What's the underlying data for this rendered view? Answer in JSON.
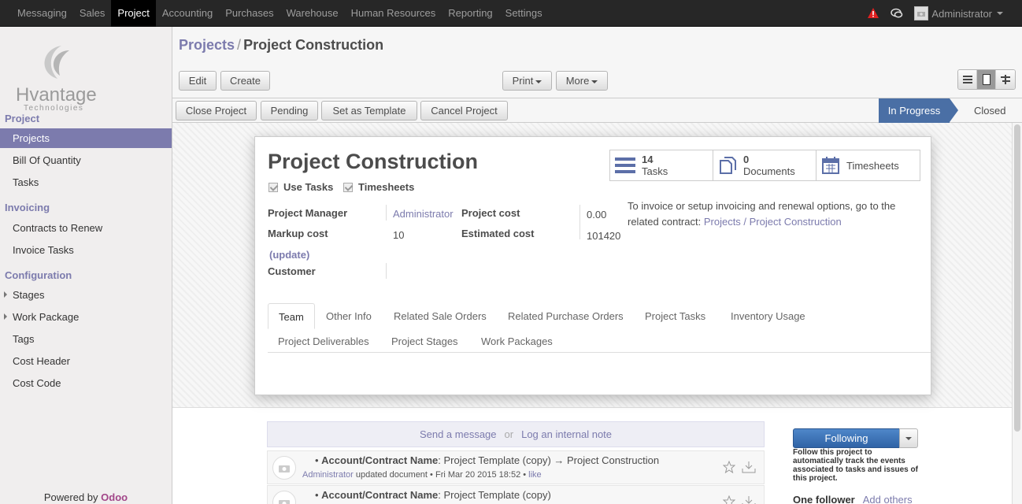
{
  "topnav": {
    "items": [
      "Messaging",
      "Sales",
      "Project",
      "Accounting",
      "Purchases",
      "Warehouse",
      "Human Resources",
      "Reporting",
      "Settings"
    ],
    "active_index": 2,
    "user": "Administrator"
  },
  "sidebar": {
    "logo_text": "Hvantage",
    "logo_sub": "Technologies",
    "sections": {
      "project": "Project",
      "invoicing": "Invoicing",
      "configuration": "Configuration"
    },
    "project_items": [
      "Projects",
      "Bill Of Quantity",
      "Tasks"
    ],
    "invoicing_items": [
      "Contracts to Renew",
      "Invoice Tasks"
    ],
    "configuration_items": [
      "Stages",
      "Work Package",
      "Tags",
      "Cost Header",
      "Cost Code"
    ],
    "powered_by": "Powered by",
    "powered_brand": "Odoo"
  },
  "breadcrumb": {
    "parent": "Projects",
    "separator": "/",
    "current": "Project Construction"
  },
  "toolbar": {
    "edit": "Edit",
    "create": "Create",
    "print": "Print",
    "more": "More"
  },
  "actions": {
    "close_project": "Close Project",
    "pending": "Pending",
    "set_template": "Set as Template",
    "cancel_project": "Cancel Project"
  },
  "stages": {
    "current": "In Progress",
    "next": "Closed"
  },
  "form": {
    "title": "Project Construction",
    "use_tasks": "Use Tasks",
    "timesheets": "Timesheets",
    "smart_buttons": {
      "tasks_count": "14",
      "tasks_label": "Tasks",
      "docs_count": "0",
      "docs_label": "Documents",
      "timesheets_label": "Timesheets"
    },
    "project_manager_label": "Project Manager",
    "project_manager_value": "Administrator",
    "markup_cost_label": "Markup cost",
    "markup_cost_value": "10",
    "update_link": "(update)",
    "customer_label": "Customer",
    "project_cost_label": "Project cost",
    "project_cost_value": "0.00",
    "estimated_cost_label": "Estimated cost",
    "estimated_cost_value": "101420",
    "note_text": "To invoice or setup invoicing and renewal options, go to the related contract:",
    "note_link": "Projects / Project Construction",
    "tabs_row1": [
      "Team",
      "Other Info",
      "Related Sale Orders",
      "Related Purchase Orders",
      "Project Tasks",
      "Inventory Usage"
    ],
    "tabs_row2": [
      "Project Deliverables",
      "Project Stages",
      "Work Packages"
    ]
  },
  "chatter": {
    "send_message": "Send a message",
    "or": "or",
    "log_note": "Log an internal note",
    "messages": [
      {
        "field": "Account/Contract Name",
        "change": ": Project Template (copy) → Project Construction",
        "author": "Administrator",
        "action": "updated document",
        "date": "Fri Mar 20 2015 18:52",
        "like": "like"
      },
      {
        "field": "Account/Contract Name",
        "change": ": Project Template (copy)"
      }
    ],
    "following_button": "Following",
    "follow_note": "Follow this project to automatically track the events associated to tasks and issues of this project.",
    "followers_count": "One follower",
    "add_others": "Add others"
  }
}
